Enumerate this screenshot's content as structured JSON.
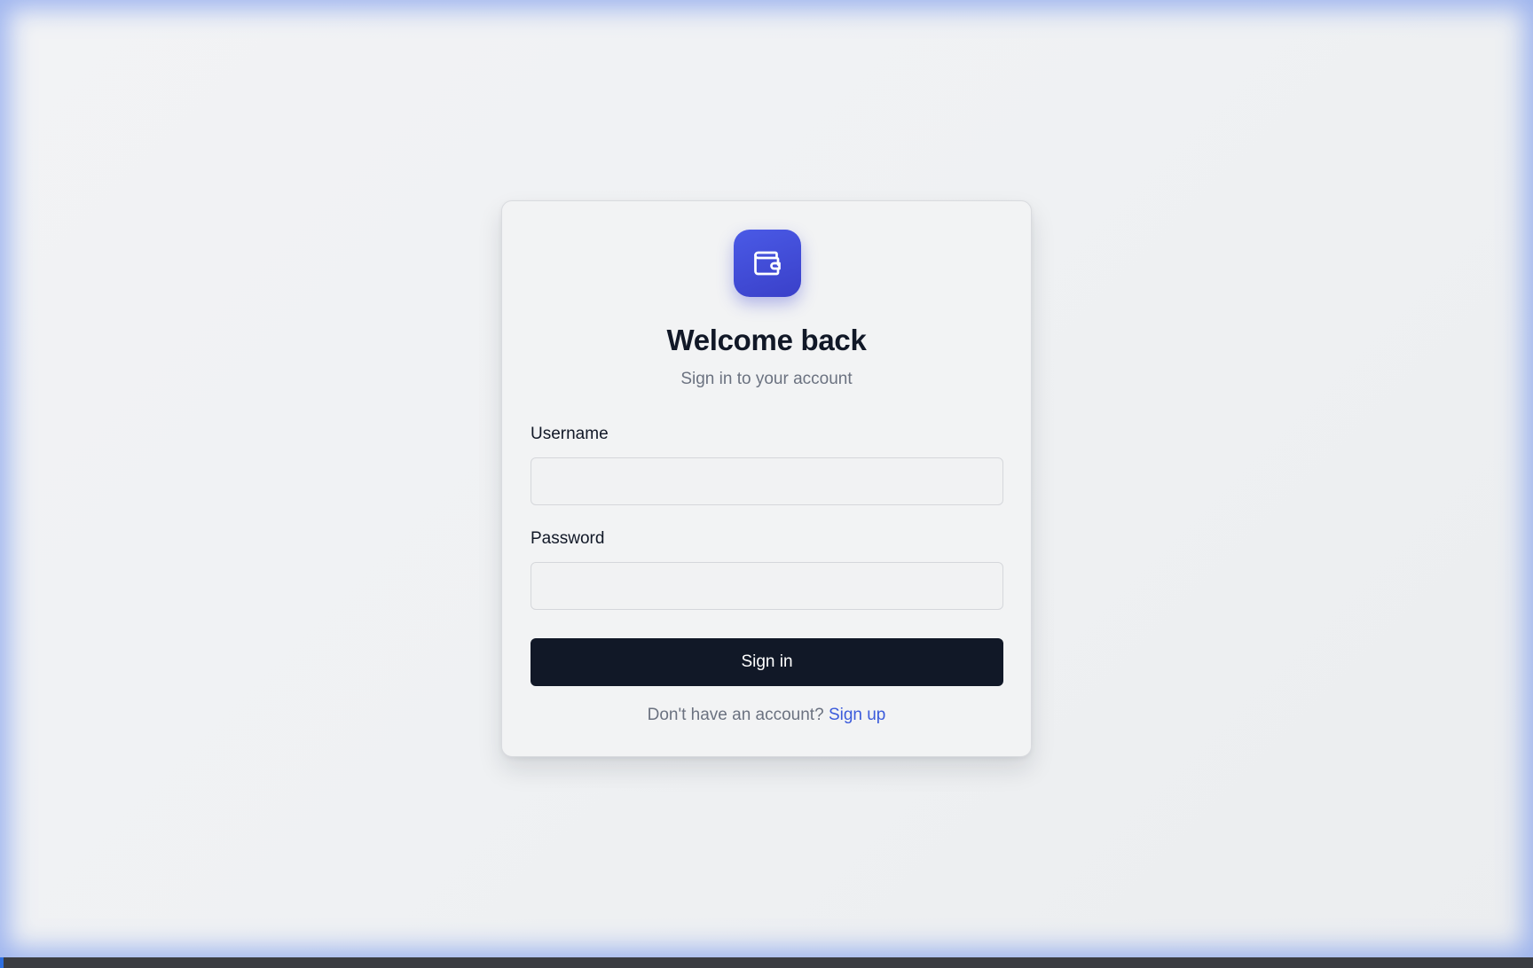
{
  "auth": {
    "logo_icon": "wallet-icon",
    "title": "Welcome back",
    "subtitle": "Sign in to your account",
    "username_label": "Username",
    "username_value": "",
    "password_label": "Password",
    "password_value": "",
    "submit_label": "Sign in",
    "footer_text": "Don't have an account?",
    "signup_link": "Sign up"
  },
  "colors": {
    "accent": "#4450dc",
    "button": "#111827",
    "link": "#3b5bdb"
  }
}
